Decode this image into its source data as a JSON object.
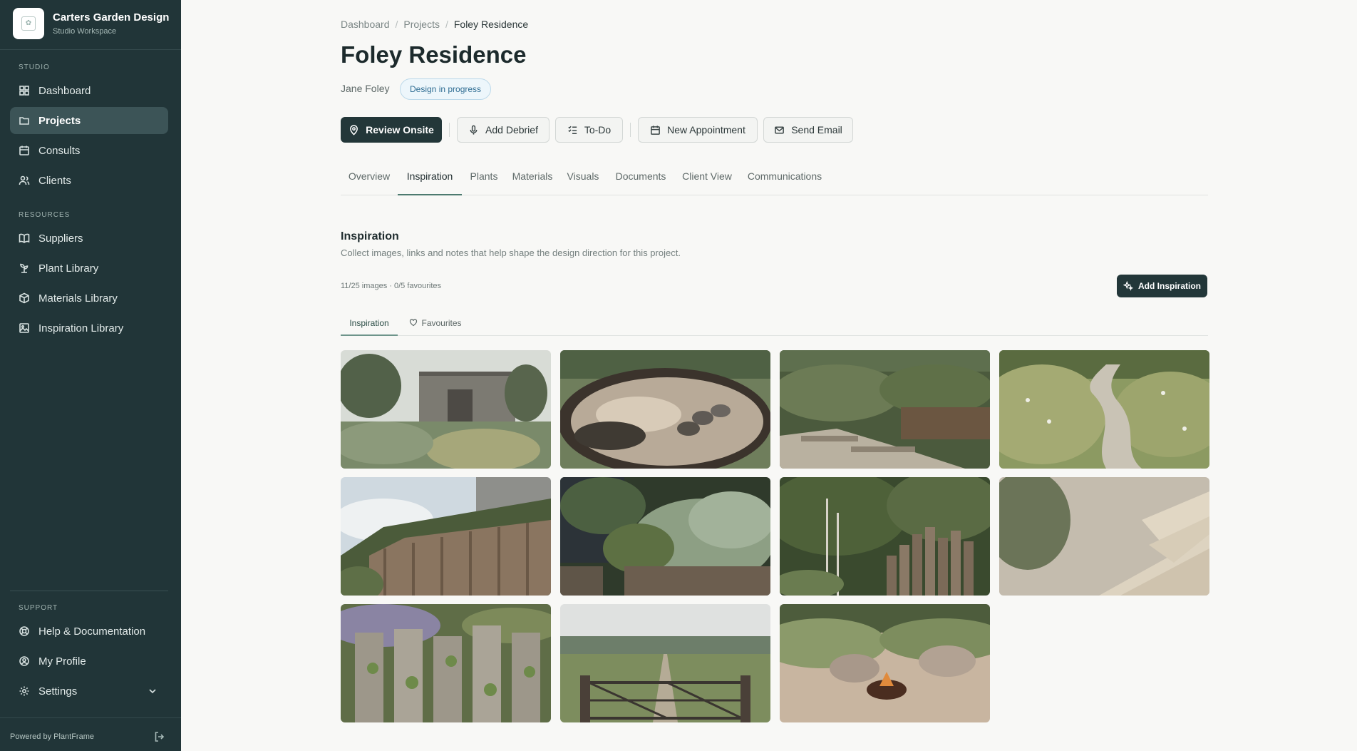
{
  "brand": {
    "name": "Carters Garden Design",
    "subtitle": "Studio Workspace"
  },
  "sidebar": {
    "sections": {
      "studio": "STUDIO",
      "resources": "RESOURCES",
      "support": "SUPPORT"
    },
    "studio_items": [
      {
        "label": "Dashboard",
        "icon": "dashboard-icon"
      },
      {
        "label": "Projects",
        "icon": "folder-icon",
        "active": true
      },
      {
        "label": "Consults",
        "icon": "calendar-icon"
      },
      {
        "label": "Clients",
        "icon": "users-icon"
      }
    ],
    "resource_items": [
      {
        "label": "Suppliers",
        "icon": "book-icon"
      },
      {
        "label": "Plant Library",
        "icon": "sprout-icon"
      },
      {
        "label": "Materials Library",
        "icon": "package-icon"
      },
      {
        "label": "Inspiration Library",
        "icon": "image-icon"
      }
    ],
    "support_items": [
      {
        "label": "Help & Documentation",
        "icon": "lifebuoy-icon"
      },
      {
        "label": "My Profile",
        "icon": "user-circle-icon"
      },
      {
        "label": "Settings",
        "icon": "gear-icon"
      }
    ],
    "footer": "Powered by PlantFrame"
  },
  "breadcrumb": [
    "Dashboard",
    "Projects",
    "Foley Residence"
  ],
  "page": {
    "title": "Foley Residence",
    "client": "Jane Foley",
    "status": "Design in progress"
  },
  "actions": {
    "review_onsite": "Review Onsite",
    "add_debrief": "Add Debrief",
    "todo": "To-Do",
    "new_appointment": "New Appointment",
    "send_email": "Send Email"
  },
  "tabs": [
    "Overview",
    "Inspiration",
    "Plants",
    "Materials",
    "Visuals",
    "Documents",
    "Client View",
    "Communications"
  ],
  "active_tab": "Inspiration",
  "inspiration": {
    "title": "Inspiration",
    "description": "Collect images, links and notes that help shape the design direction for this project.",
    "counts": "11/25 images · 0/5 favourites",
    "add_button": "Add Inspiration",
    "subtabs": [
      "Inspiration",
      "Favourites"
    ],
    "active_subtab": "Inspiration"
  },
  "gallery": [
    {
      "subject": "timber cabin with coastal planting"
    },
    {
      "subject": "reflective pond with boulders"
    },
    {
      "subject": "gravel steps with grasses"
    },
    {
      "subject": "gravel path through meadow"
    },
    {
      "subject": "timber retaining wall with grasses"
    },
    {
      "subject": "raised planter with shrubs"
    },
    {
      "subject": "timber post edging with birch"
    },
    {
      "subject": "timber steps and gravel"
    },
    {
      "subject": "timber posts with climbers"
    },
    {
      "subject": "farm gate and driveway"
    },
    {
      "subject": "fire pit with boulders"
    }
  ],
  "colors": {
    "sidebar_bg": "#213538",
    "sidebar_active": "#3c5457",
    "primary_button": "#233739",
    "badge_text": "#2f6d93",
    "tab_underline": "#4d7a6f"
  }
}
